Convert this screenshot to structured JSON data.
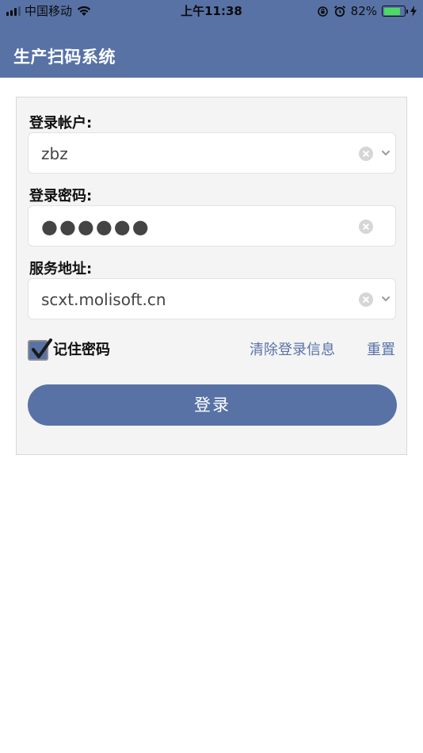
{
  "status_bar": {
    "carrier": "中国移动",
    "time": "上午11:38",
    "battery": "82%",
    "battery_level": 0.82
  },
  "header": {
    "title": "生产扫码系统"
  },
  "form": {
    "account": {
      "label": "登录帐户:",
      "value": "zbz"
    },
    "password": {
      "label": "登录密码:",
      "value": "●●●●●●"
    },
    "server": {
      "label": "服务地址:",
      "value": "scxt.molisoft.cn"
    },
    "remember": {
      "label": "记住密码",
      "checked": true
    },
    "clear_info_label": "清除登录信息",
    "reset_label": "重置",
    "login_label": "登录"
  },
  "colors": {
    "primary": "#5872a6",
    "battery": "#4cd964"
  }
}
